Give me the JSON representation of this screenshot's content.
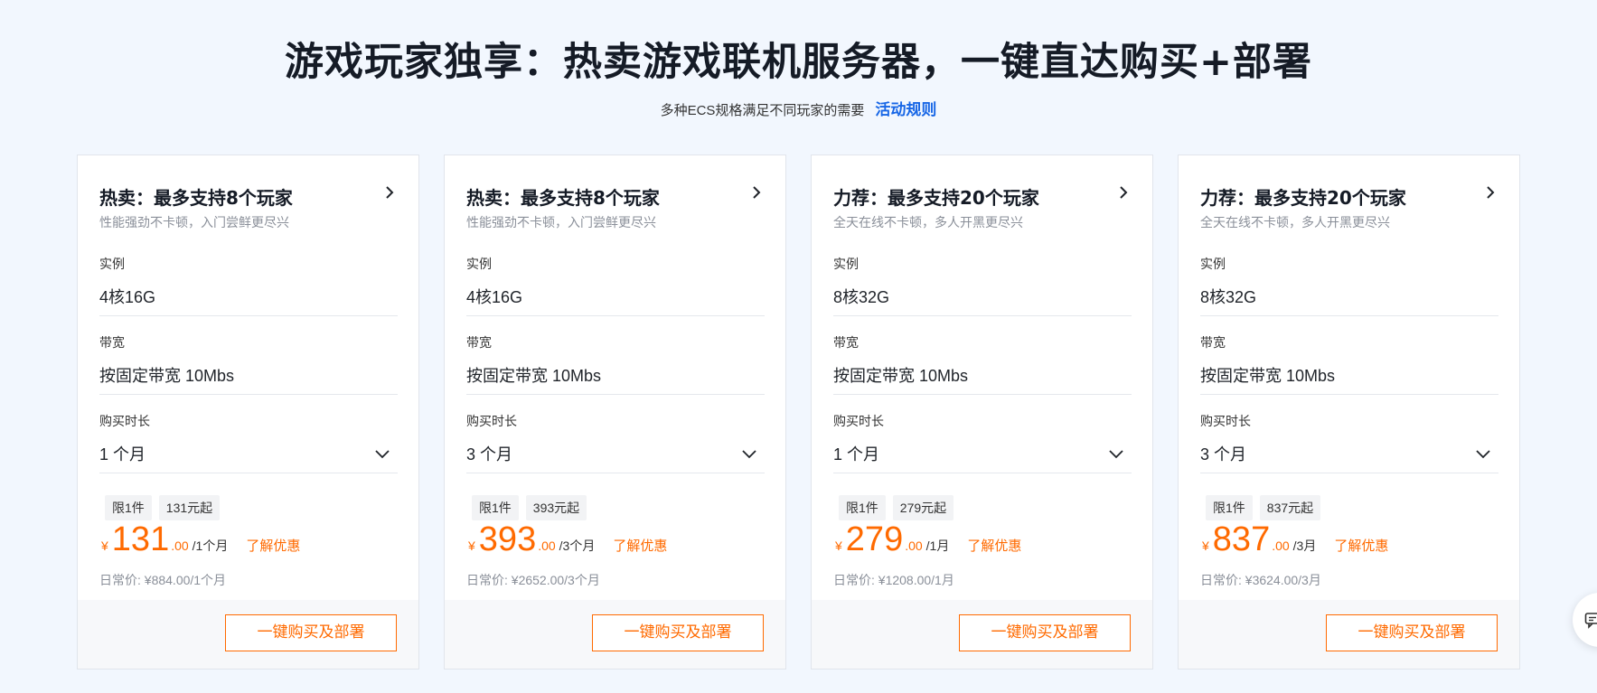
{
  "header": {
    "title": "游戏玩家独享：热卖游戏联机服务器，一键直达购买+部署",
    "subtitle": "多种ECS规格满足不同玩家的需要",
    "rules_link": "活动规则"
  },
  "labels": {
    "instance": "实例",
    "bandwidth": "带宽",
    "duration": "购买时长",
    "limit": "限1件",
    "currency": "¥",
    "discount_link": "了解优惠",
    "buy_button": "一键购买及部署"
  },
  "colors": {
    "accent": "#ff6a00",
    "link": "#1766e6",
    "background": "#f2f7fe"
  },
  "icons": {
    "card_arrow": "chevron-right-icon",
    "dropdown": "chevron-down-icon",
    "float": "chat-icon"
  },
  "cards": [
    {
      "title": "热卖：最多支持8个玩家",
      "desc": "性能强劲不卡顿，入门尝鲜更尽兴",
      "instance": "4核16G",
      "bandwidth": "按固定带宽 10Mbs",
      "duration": "1 个月",
      "from_price": "131元起",
      "price_int": "131",
      "price_dec": ".00",
      "period": "/1个月",
      "regular": "日常价: ¥884.00/1个月"
    },
    {
      "title": "热卖：最多支持8个玩家",
      "desc": "性能强劲不卡顿，入门尝鲜更尽兴",
      "instance": "4核16G",
      "bandwidth": "按固定带宽 10Mbs",
      "duration": "3 个月",
      "from_price": "393元起",
      "price_int": "393",
      "price_dec": ".00",
      "period": "/3个月",
      "regular": "日常价: ¥2652.00/3个月"
    },
    {
      "title": "力荐：最多支持20个玩家",
      "desc": "全天在线不卡顿，多人开黑更尽兴",
      "instance": "8核32G",
      "bandwidth": "按固定带宽 10Mbs",
      "duration": "1 个月",
      "from_price": "279元起",
      "price_int": "279",
      "price_dec": ".00",
      "period": "/1月",
      "regular": "日常价: ¥1208.00/1月"
    },
    {
      "title": "力荐：最多支持20个玩家",
      "desc": "全天在线不卡顿，多人开黑更尽兴",
      "instance": "8核32G",
      "bandwidth": "按固定带宽 10Mbs",
      "duration": "3 个月",
      "from_price": "837元起",
      "price_int": "837",
      "price_dec": ".00",
      "period": "/3月",
      "regular": "日常价: ¥3624.00/3月"
    }
  ]
}
